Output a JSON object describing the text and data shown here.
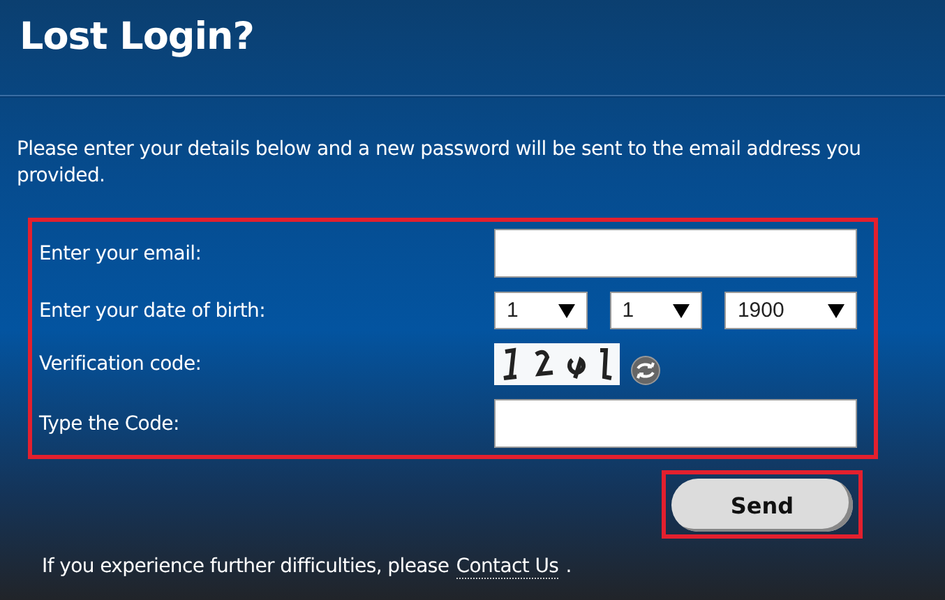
{
  "title": "Lost Login?",
  "intro": "Please enter your details below and a new password will be sent to the email address you provided.",
  "form": {
    "email_label": "Enter your email:",
    "dob_label": "Enter your date of birth:",
    "dob": [
      {
        "value": "1",
        "kind": "day"
      },
      {
        "value": "1",
        "kind": "month"
      },
      {
        "value": "1900",
        "kind": "year"
      }
    ],
    "verification_label": "Verification code:",
    "code_label": "Type the Code:"
  },
  "send_button": "Send",
  "footer": {
    "text": "If you experience further difficulties, please",
    "link": "Contact Us",
    "end": "."
  }
}
